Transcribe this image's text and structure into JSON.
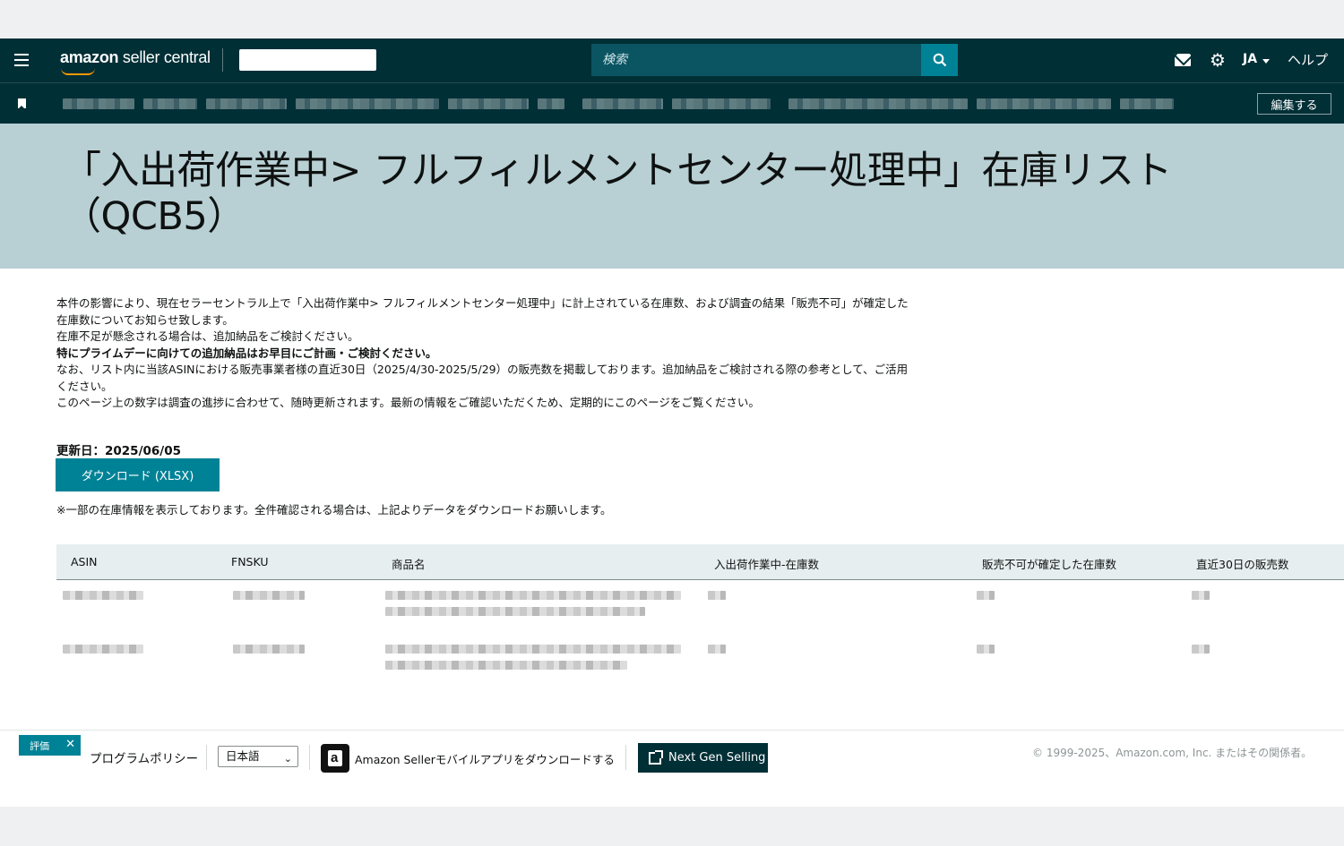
{
  "header": {
    "logo_brand": "amazon",
    "logo_rest": " seller central",
    "search_placeholder": "検索",
    "lang": "JA",
    "help": "ヘルプ"
  },
  "subnav": {
    "edit_label": "編集する"
  },
  "page": {
    "title": "「入出荷作業中> フルフィルメントセンター処理中」在庫リスト（QCB5）",
    "notice": [
      "本件の影響により、現在セラーセントラル上で「入出荷作業中> フルフィルメントセンター処理中」に計上されている在庫数、および調査の結果「販売不可」が確定した在庫数についてお知らせ致します。",
      "在庫不足が懸念される場合は、追加納品をご検討ください。",
      "特にプライムデーに向けての追加納品はお早目にご計画・ご検討ください。",
      "なお、リスト内に当該ASINにおける販売事業者様の直近30日（2025/4/30-2025/5/29）の販売数を掲載しております。追加納品をご検討される際の参考として、ご活用ください。",
      "このページ上の数字は調査の進捗に合わせて、随時更新されます。最新の情報をご確認いただくため、定期的にこのページをご覧ください。"
    ],
    "updated": "更新日：2025/06/05",
    "download_label": "ダウンロード (XLSX)",
    "partial_note": "※一部の在庫情報を表示しております。全件確認される場合は、上記よりデータをダウンロードお願いします。"
  },
  "table": {
    "headers": [
      "ASIN",
      "FNSKU",
      "商品名",
      "入出荷作業中-在庫数",
      "販売不可が確定した在庫数",
      "直近30日の販売数"
    ]
  },
  "footer": {
    "eval_label": "評価",
    "policy": "プログラムポリシー",
    "language": "日本語",
    "app_link": "Amazon Sellerモバイルアプリをダウンロードする",
    "next_gen": "Next Gen Selling",
    "copyright": "© 1999-2025、Amazon.com, Inc. またはその関係者。"
  },
  "colors": {
    "nav": "#002f36",
    "accent": "#008296",
    "hero": "#b8d0d4"
  }
}
